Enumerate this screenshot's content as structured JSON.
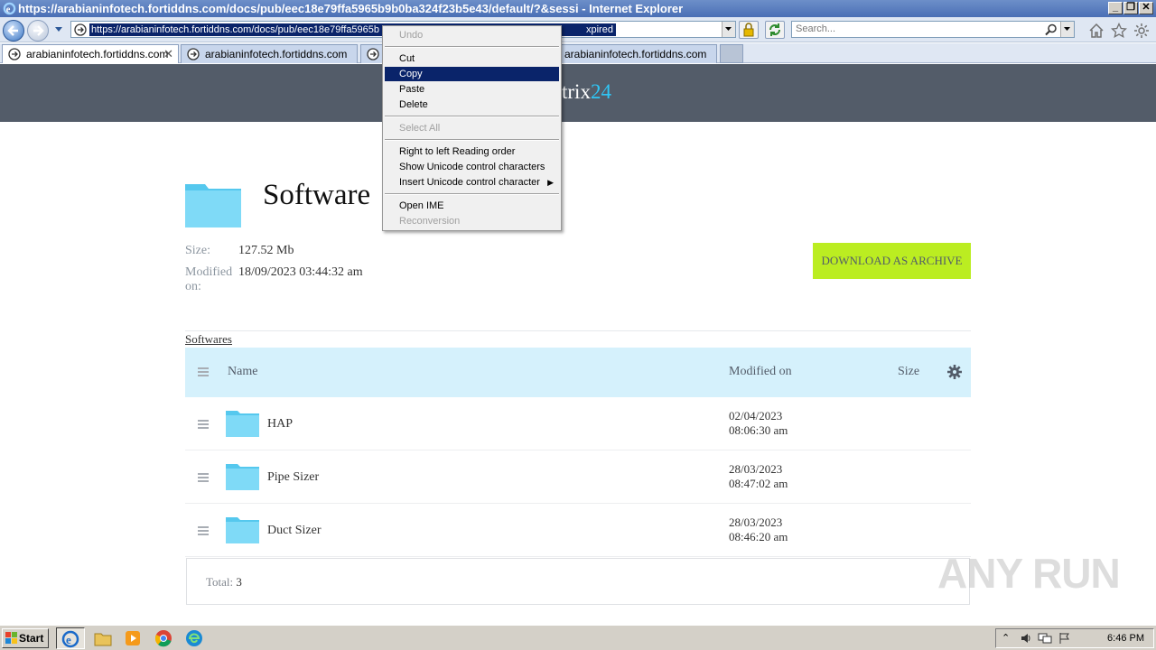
{
  "browser": {
    "title": "https://arabianinfotech.fortiddns.com/docs/pub/eec18e79ffa5965b9b0ba324f23b5e43/default/?&sessi - Internet Explorer",
    "address_url": "https://arabianinfotech.fortiddns.com/docs/pub/eec18e79ffa5965b",
    "address_url_tail": "xpired",
    "search_placeholder": "Search...",
    "tabs": [
      {
        "label": "arabianinfotech.fortiddns.com"
      },
      {
        "label": "arabianinfotech.fortiddns.com"
      },
      {
        "label": "arabianinfotech.fortiddns.com"
      }
    ]
  },
  "context_menu": {
    "items": [
      {
        "label": "Undo",
        "state": "disabled"
      },
      {
        "label": "Cut",
        "state": "normal"
      },
      {
        "label": "Copy",
        "state": "selected"
      },
      {
        "label": "Paste",
        "state": "normal"
      },
      {
        "label": "Delete",
        "state": "normal"
      },
      {
        "label": "Select All",
        "state": "disabled"
      },
      {
        "label": "Right to left Reading order",
        "state": "normal"
      },
      {
        "label": "Show Unicode control characters",
        "state": "normal"
      },
      {
        "label": "Insert Unicode control character",
        "state": "normal",
        "submenu": true
      },
      {
        "label": "Open IME",
        "state": "normal"
      },
      {
        "label": "Reconversion",
        "state": "disabled"
      }
    ]
  },
  "site": {
    "brand_text": "trix",
    "brand_accent": "24",
    "brand_accent_color": "#2fc6f6",
    "header_bg": "#535c69"
  },
  "folder": {
    "title": "Software",
    "size_label": "Size:",
    "size_value": "127.52 Mb",
    "modified_label_1": "Modified",
    "modified_label_2": "on:",
    "modified_value": "18/09/2023 03:44:32 am",
    "download_label": "DOWNLOAD AS ARCHIVE",
    "download_color": "#bbed21",
    "breadcrumb": "Softwares"
  },
  "table": {
    "headers": {
      "name": "Name",
      "modified": "Modified on",
      "size": "Size"
    },
    "rows": [
      {
        "name": "HAP",
        "date": "02/04/2023",
        "time": "08:06:30 am"
      },
      {
        "name": "Pipe Sizer",
        "date": "28/03/2023",
        "time": "08:47:02 am"
      },
      {
        "name": "Duct Sizer",
        "date": "28/03/2023",
        "time": "08:46:20 am"
      }
    ],
    "total_label": "Total:",
    "total_value": "3"
  },
  "watermark": "ANY RUN",
  "taskbar": {
    "start_label": "Start",
    "clock": "6:46 PM",
    "icons": [
      "ie-icon",
      "explorer-icon",
      "media-player-icon",
      "chrome-icon",
      "edge-icon"
    ]
  }
}
